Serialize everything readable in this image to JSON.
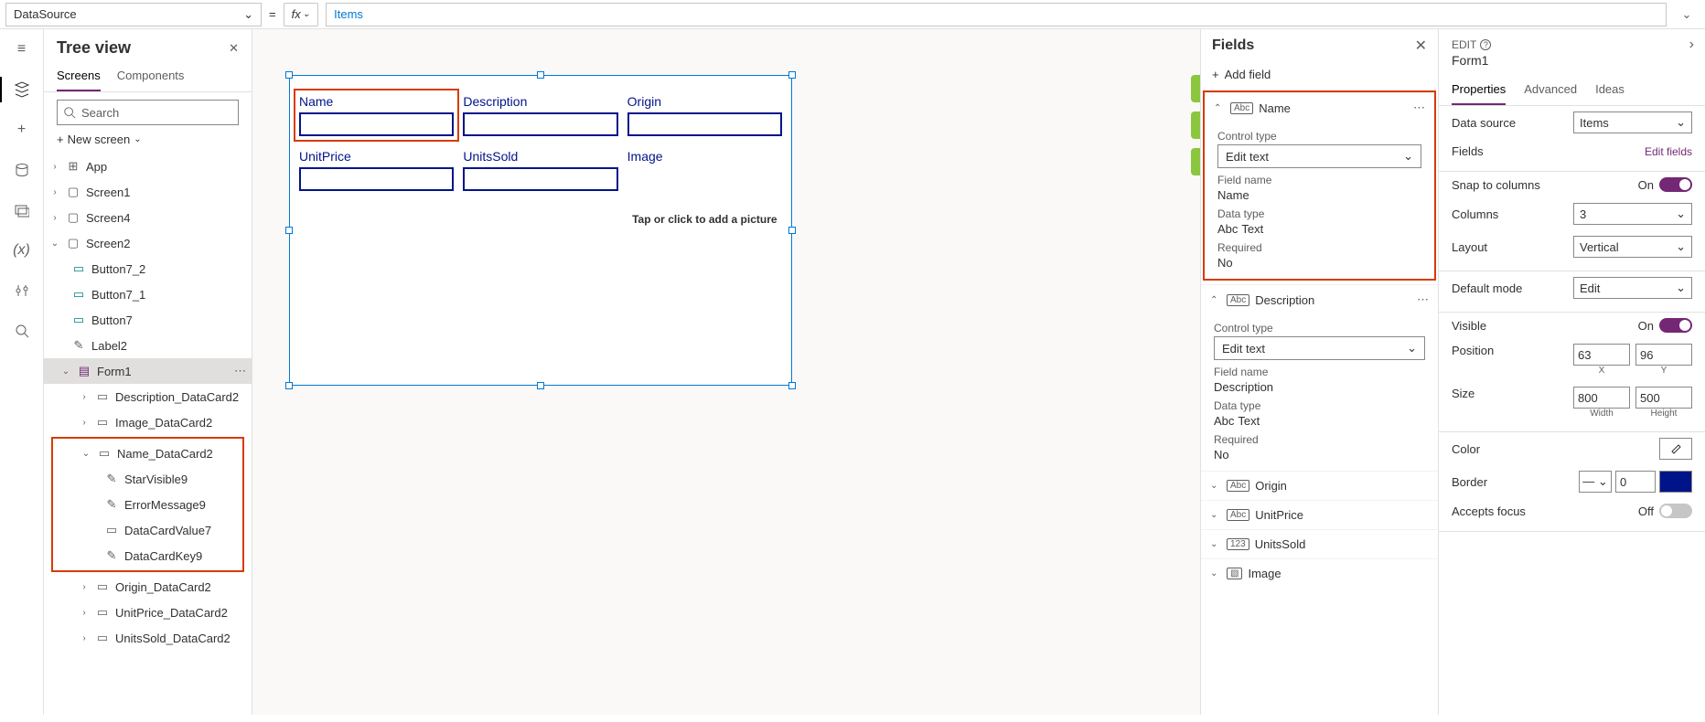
{
  "formulaBar": {
    "property": "DataSource",
    "equals": "=",
    "fx": "fx",
    "value": "Items"
  },
  "leftRail": {
    "icons": [
      "hamburger",
      "layers",
      "plus",
      "database",
      "media",
      "variables",
      "tools",
      "search"
    ]
  },
  "treeView": {
    "title": "Tree view",
    "tabs": {
      "screens": "Screens",
      "components": "Components"
    },
    "searchPlaceholder": "Search",
    "newScreen": "New screen",
    "nodes": {
      "app": "App",
      "screen1": "Screen1",
      "screen4": "Screen4",
      "screen2": "Screen2",
      "button7_2": "Button7_2",
      "button7_1": "Button7_1",
      "button7": "Button7",
      "label2": "Label2",
      "form1": "Form1",
      "desc": "Description_DataCard2",
      "image": "Image_DataCard2",
      "name": "Name_DataCard2",
      "star": "StarVisible9",
      "err": "ErrorMessage9",
      "dcv": "DataCardValue7",
      "dck": "DataCardKey9",
      "origin": "Origin_DataCard2",
      "unitprice": "UnitPrice_DataCard2",
      "unitssold": "UnitsSold_DataCard2"
    }
  },
  "canvas": {
    "cards": {
      "name": "Name",
      "description": "Description",
      "origin": "Origin",
      "unitprice": "UnitPrice",
      "unitssold": "UnitsSold",
      "image": "Image",
      "imageHint": "Tap or click to add a picture"
    }
  },
  "fieldsPanel": {
    "title": "Fields",
    "addField": "Add field",
    "controlTypeLabel": "Control type",
    "fieldNameLabel": "Field name",
    "dataTypeLabel": "Data type",
    "requiredLabel": "Required",
    "editText": "Edit text",
    "textType": "Text",
    "no": "No",
    "fields": {
      "name": "Name",
      "description": "Description",
      "origin": "Origin",
      "unitprice": "UnitPrice",
      "unitssold": "UnitsSold",
      "image": "Image"
    }
  },
  "propsPanel": {
    "editLabel": "EDIT",
    "ctrlName": "Form1",
    "tabs": {
      "properties": "Properties",
      "advanced": "Advanced",
      "ideas": "Ideas"
    },
    "dataSource": {
      "label": "Data source",
      "value": "Items"
    },
    "fieldsRow": {
      "label": "Fields",
      "link": "Edit fields"
    },
    "snapToColumns": {
      "label": "Snap to columns",
      "value": "On"
    },
    "columns": {
      "label": "Columns",
      "value": "3"
    },
    "layout": {
      "label": "Layout",
      "value": "Vertical"
    },
    "defaultMode": {
      "label": "Default mode",
      "value": "Edit"
    },
    "visible": {
      "label": "Visible",
      "value": "On"
    },
    "position": {
      "label": "Position",
      "x": "63",
      "y": "96",
      "xl": "X",
      "yl": "Y"
    },
    "size": {
      "label": "Size",
      "w": "800",
      "h": "500",
      "wl": "Width",
      "hl": "Height"
    },
    "color": {
      "label": "Color"
    },
    "border": {
      "label": "Border",
      "width": "0"
    },
    "acceptsFocus": {
      "label": "Accepts focus",
      "value": "Off"
    }
  }
}
